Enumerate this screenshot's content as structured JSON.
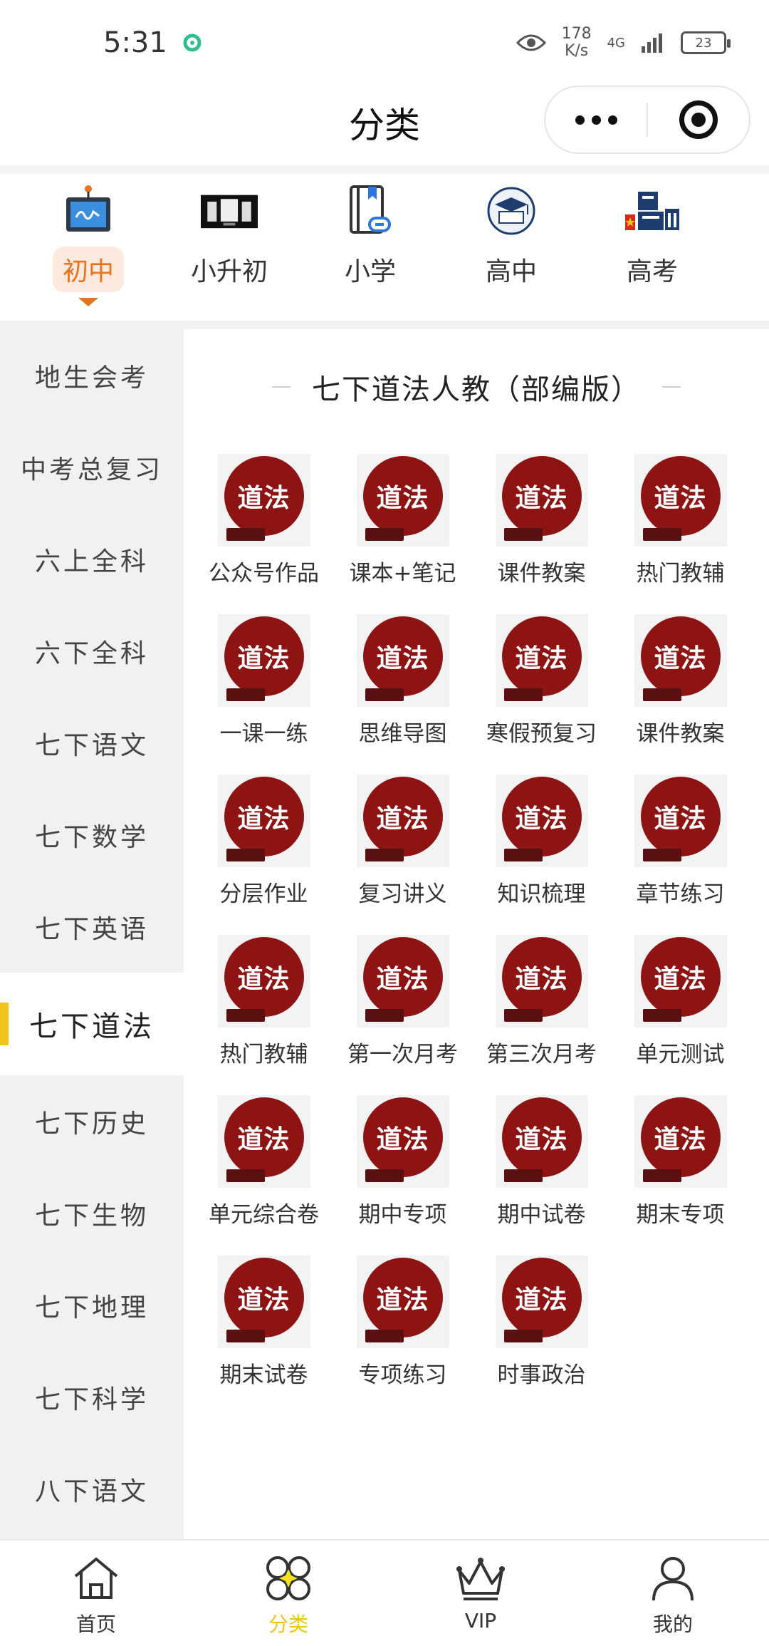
{
  "status_bar": {
    "time": "5:31",
    "net_speed_value": "178",
    "net_speed_unit": "K/s",
    "network": "4G",
    "battery": "23"
  },
  "header": {
    "title": "分类"
  },
  "categories": [
    {
      "label": "初中",
      "icon": "monitor-icon",
      "active": true
    },
    {
      "label": "小升初",
      "icon": "banner-image-icon",
      "active": false
    },
    {
      "label": "小学",
      "icon": "book-link-icon",
      "active": false
    },
    {
      "label": "高中",
      "icon": "graduation-cap-icon",
      "active": false
    },
    {
      "label": "高考",
      "icon": "gaokao-badge-icon",
      "active": false
    }
  ],
  "sidebar": {
    "items": [
      {
        "label": "地生会考"
      },
      {
        "label": "中考总复习"
      },
      {
        "label": "六上全科"
      },
      {
        "label": "六下全科"
      },
      {
        "label": "七下语文"
      },
      {
        "label": "七下数学"
      },
      {
        "label": "七下英语"
      },
      {
        "label": "七下道法",
        "active": true
      },
      {
        "label": "七下历史"
      },
      {
        "label": "七下生物"
      },
      {
        "label": "七下地理"
      },
      {
        "label": "七下科学"
      },
      {
        "label": "八下语文"
      }
    ]
  },
  "main": {
    "section_title": "七下道法人教（部编版）",
    "tile_badge": "道法",
    "tiles": [
      {
        "label": "公众号作品"
      },
      {
        "label": "课本+笔记"
      },
      {
        "label": "课件教案"
      },
      {
        "label": "热门教辅"
      },
      {
        "label": "一课一练"
      },
      {
        "label": "思维导图"
      },
      {
        "label": "寒假预复习"
      },
      {
        "label": "课件教案"
      },
      {
        "label": "分层作业"
      },
      {
        "label": "复习讲义"
      },
      {
        "label": "知识梳理"
      },
      {
        "label": "章节练习"
      },
      {
        "label": "热门教辅"
      },
      {
        "label": "第一次月考"
      },
      {
        "label": "第三次月考"
      },
      {
        "label": "单元测试"
      },
      {
        "label": "单元综合卷"
      },
      {
        "label": "期中专项"
      },
      {
        "label": "期中试卷"
      },
      {
        "label": "期末专项"
      },
      {
        "label": "期末试卷"
      },
      {
        "label": "专项练习"
      },
      {
        "label": "时事政治"
      }
    ]
  },
  "tabbar": {
    "items": [
      {
        "label": "首页",
        "icon": "home-icon"
      },
      {
        "label": "分类",
        "icon": "category-icon",
        "active": true
      },
      {
        "label": "VIP",
        "icon": "crown-icon"
      },
      {
        "label": "我的",
        "icon": "user-icon"
      }
    ]
  },
  "colors": {
    "accent_orange": "#e8731e",
    "accent_yellow": "#f4c21c",
    "tile_red": "#8e1414",
    "sidebar_bg": "#f1f1f1"
  }
}
